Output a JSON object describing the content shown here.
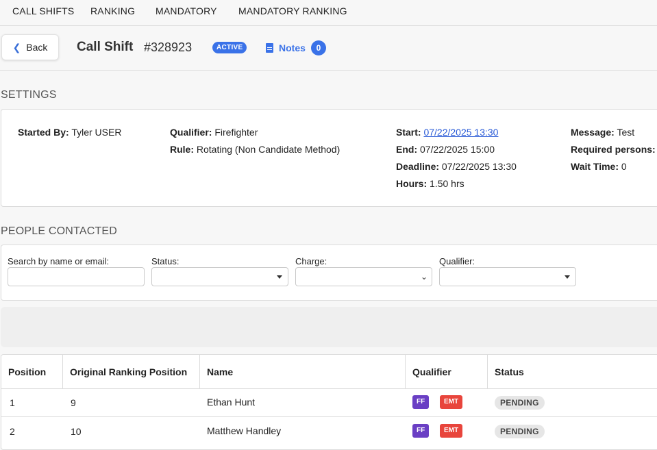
{
  "nav": {
    "items": [
      "CALL SHIFTS",
      "RANKING",
      "MANDATORY",
      "MANDATORY RANKING"
    ]
  },
  "header": {
    "back_label": "Back",
    "title": "Call Shift",
    "shift_id": "#328923",
    "status_badge": "ACTIVE",
    "notes_label": "Notes",
    "notes_count": "0"
  },
  "settings": {
    "heading": "SETTINGS",
    "started_by_label": "Started By:",
    "started_by": "Tyler USER",
    "qualifier_label": "Qualifier:",
    "qualifier": "Firefighter",
    "rule_label": "Rule:",
    "rule": "Rotating (Non Candidate Method)",
    "start_label": "Start:",
    "start": "07/22/2025 13:30",
    "end_label": "End:",
    "end": "07/22/2025 15:00",
    "deadline_label": "Deadline:",
    "deadline": "07/22/2025 13:30",
    "hours_label": "Hours:",
    "hours": "1.50 hrs",
    "message_label": "Message:",
    "message": "Test",
    "required_label": "Required persons:",
    "wait_label": "Wait Time:",
    "wait": "0"
  },
  "people": {
    "heading": "PEOPLE CONTACTED",
    "search_label": "Search by name or email:",
    "search_value": "",
    "status_label": "Status:",
    "charge_label": "Charge:",
    "qualifier_label": "Qualifier:"
  },
  "table": {
    "headers": [
      "Position",
      "Original Ranking Position",
      "Name",
      "Qualifier",
      "Status"
    ],
    "rows": [
      {
        "position": "1",
        "original": "9",
        "name": "Ethan Hunt",
        "q1": "FF",
        "q2": "EMT",
        "status": "PENDING"
      },
      {
        "position": "2",
        "original": "10",
        "name": "Matthew Handley",
        "q1": "FF",
        "q2": "EMT",
        "status": "PENDING"
      }
    ]
  },
  "colors": {
    "accent": "#3a72e8",
    "ff_badge": "#6a3fc4",
    "emt_badge": "#e8453c"
  }
}
